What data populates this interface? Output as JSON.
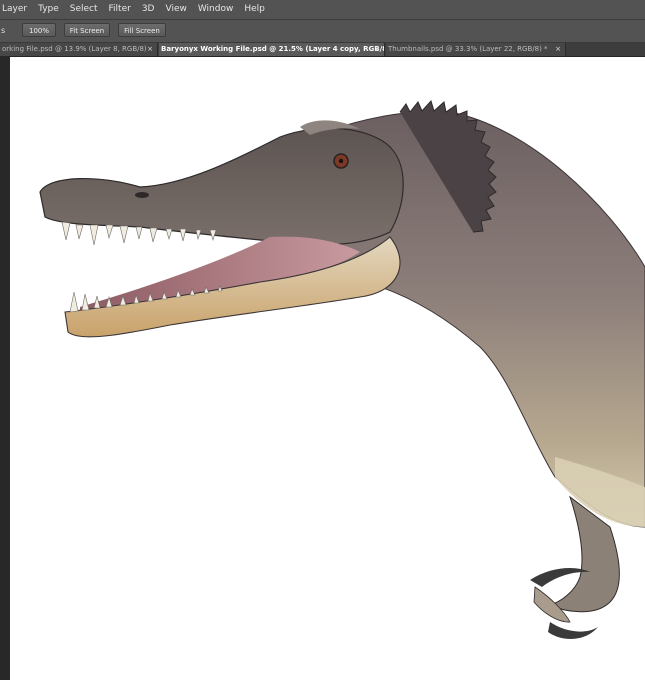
{
  "menu": {
    "items": [
      "Layer",
      "Type",
      "Select",
      "Filter",
      "3D",
      "View",
      "Window",
      "Help"
    ]
  },
  "options": {
    "fragment": "s",
    "zoom_label": "100%",
    "fit_label": "Fit Screen",
    "fill_label": "Fill Screen"
  },
  "tabs": [
    {
      "label": "orking File.psd @ 13.9% (Layer 8, RGB/8)",
      "close": "×",
      "active": false
    },
    {
      "label": "Baryonyx Working File.psd @ 21.5% (Layer 4 copy, RGB/8)",
      "close": "×",
      "active": true
    },
    {
      "label": "Thumbnails.psd @ 33.3% (Layer 22, RGB/8) *",
      "close": "×",
      "active": false
    }
  ],
  "canvas": {
    "background": "#ffffff",
    "subject_colors": {
      "skin_dark": "#5c5450",
      "skin_mid": "#8a7c76",
      "belly": "#d6cdb0",
      "jaw_tan": "#c9a876",
      "mouth_pink": "#b37a84",
      "teeth": "#f1ece0",
      "claw": "#3a3a3a"
    }
  }
}
